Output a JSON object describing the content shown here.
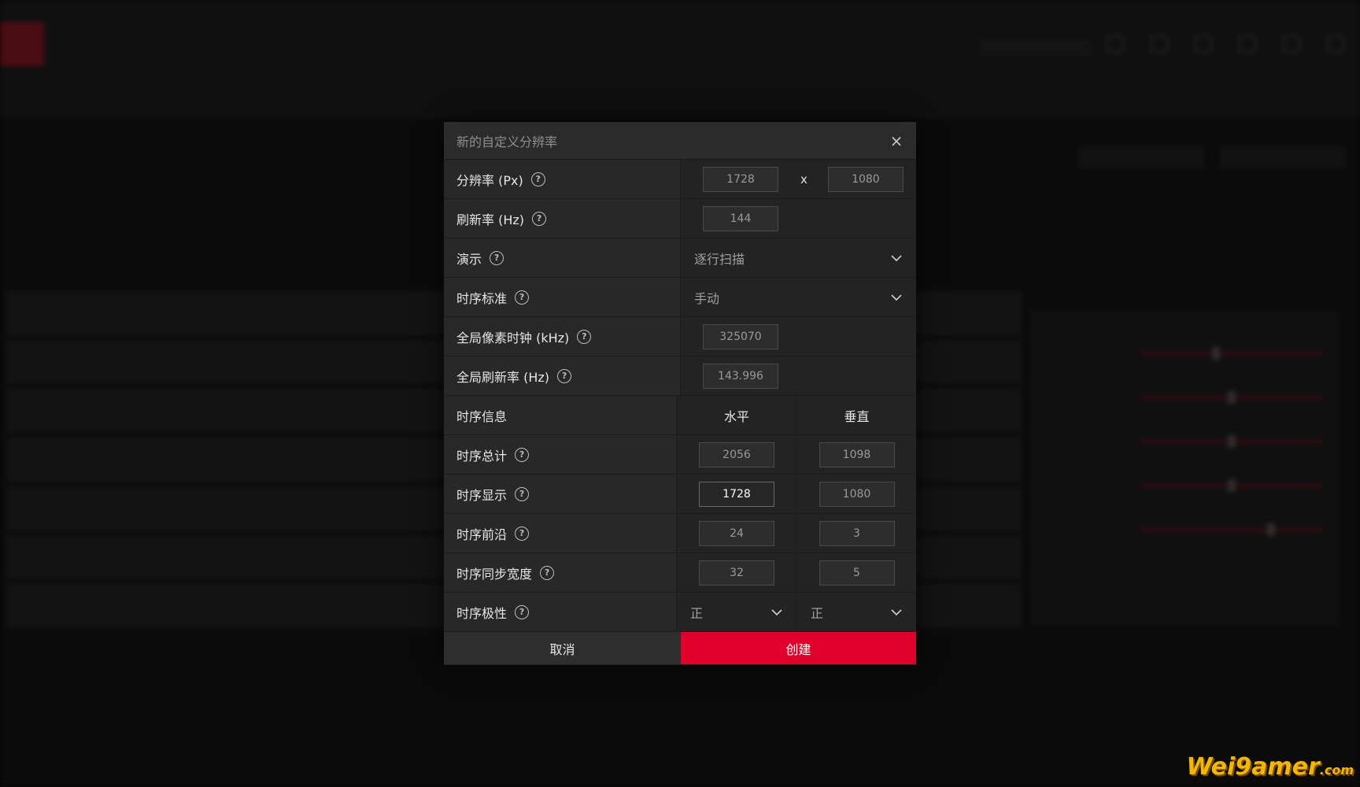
{
  "dialog": {
    "title": "新的自定义分辨率",
    "close_icon": "×",
    "rows": {
      "resolution": {
        "label": "分辨率 (Px)",
        "width": "1728",
        "separator": "x",
        "height": "1080"
      },
      "refresh": {
        "label": "刷新率 (Hz)",
        "value": "144"
      },
      "presentation": {
        "label": "演示",
        "value": "逐行扫描"
      },
      "timing_standard": {
        "label": "时序标准",
        "value": "手动"
      },
      "pixel_clock": {
        "label": "全局像素时钟 (kHz)",
        "value": "325070"
      },
      "global_refresh": {
        "label": "全局刷新率 (Hz)",
        "value": "143.996"
      },
      "timing_info": {
        "label": "时序信息",
        "horizontal": "水平",
        "vertical": "垂直"
      },
      "timing_total": {
        "label": "时序总计",
        "h": "2056",
        "v": "1098"
      },
      "timing_display": {
        "label": "时序显示",
        "h": "1728",
        "v": "1080"
      },
      "front_porch": {
        "label": "时序前沿",
        "h": "24",
        "v": "3"
      },
      "sync_width": {
        "label": "时序同步宽度",
        "h": "32",
        "v": "5"
      },
      "polarity": {
        "label": "时序极性",
        "h": "正",
        "v": "正"
      }
    },
    "buttons": {
      "cancel": "取消",
      "create": "创建"
    }
  },
  "watermark": {
    "text": "Wei9amer",
    "suffix": ".com"
  },
  "colors": {
    "accent": "#e0002c",
    "dialog_bg": "#262626"
  },
  "icons": {
    "help": "help-circle-icon",
    "close": "close-icon",
    "chevron": "chevron-down-icon"
  }
}
